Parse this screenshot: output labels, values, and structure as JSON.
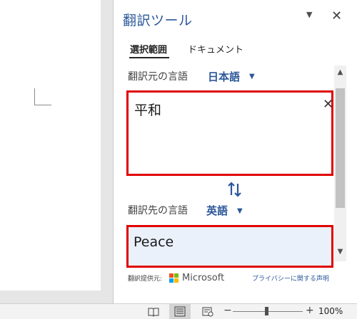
{
  "pane": {
    "title": "翻訳ツール",
    "menu_icon": "▼",
    "close_icon": "✕",
    "tabs": [
      {
        "label": "選択範囲",
        "active": true
      },
      {
        "label": "ドキュメント",
        "active": false
      }
    ]
  },
  "source": {
    "label": "翻訳元の言語",
    "language": "日本語",
    "text": "平和",
    "clear_icon": "✕"
  },
  "swap_icon": "⇅",
  "target": {
    "label": "翻訳先の言語",
    "language": "英語",
    "text": "Peace"
  },
  "footer": {
    "attribution_label": "翻訳提供元:",
    "provider": "Microsoft",
    "privacy_link": "プライバシーに関する声明"
  },
  "status_bar": {
    "zoom_minus": "−",
    "zoom_plus": "+",
    "zoom_level": "100%"
  },
  "colors": {
    "accent": "#2b579a",
    "highlight_border": "#e00000",
    "ms_red": "#f25022",
    "ms_green": "#7fba00",
    "ms_blue": "#00a4ef",
    "ms_yellow": "#ffb900"
  }
}
